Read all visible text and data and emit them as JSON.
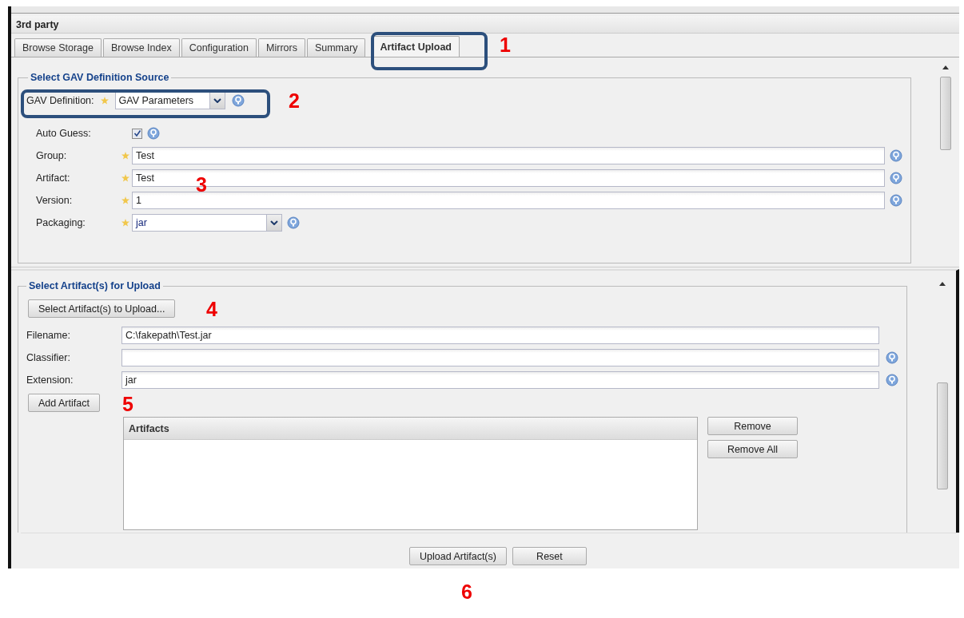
{
  "panel": {
    "title": "3rd party"
  },
  "tabs": [
    {
      "label": "Browse Storage",
      "selected": false
    },
    {
      "label": "Browse Index",
      "selected": false
    },
    {
      "label": "Configuration",
      "selected": false
    },
    {
      "label": "Mirrors",
      "selected": false
    },
    {
      "label": "Summary",
      "selected": false
    },
    {
      "label": "Artifact Upload",
      "selected": true
    }
  ],
  "gav_section": {
    "title": "Select GAV Definition Source",
    "gav_definition": {
      "label": "GAV Definition:",
      "value": "GAV Parameters",
      "required": true,
      "help": true
    },
    "fields": [
      {
        "kind": "checkbox",
        "label": "Auto Guess:",
        "checked": true,
        "required": false,
        "help": true
      },
      {
        "kind": "text",
        "label": "Group:",
        "value": "Test",
        "required": true,
        "help": true
      },
      {
        "kind": "text",
        "label": "Artifact:",
        "value": "Test",
        "required": true,
        "help": true
      },
      {
        "kind": "text",
        "label": "Version:",
        "value": "1",
        "required": true,
        "help": true
      },
      {
        "kind": "select",
        "label": "Packaging:",
        "value": "jar",
        "required": true,
        "help": true
      }
    ]
  },
  "artifact_section": {
    "title": "Select Artifact(s) for Upload",
    "select_button": "Select Artifact(s) to Upload...",
    "fields": [
      {
        "label": "Filename:",
        "value": "C:\\fakepath\\Test.jar",
        "help": false
      },
      {
        "label": "Classifier:",
        "help": true
      },
      {
        "label": "Extension:",
        "value": "jar",
        "help": true
      }
    ],
    "add_button": "Add Artifact",
    "artifacts_grid": {
      "columns": [
        "Artifacts"
      ]
    },
    "side_buttons": [
      "Remove",
      "Remove All"
    ]
  },
  "footer_buttons": [
    "Upload Artifact(s)",
    "Reset"
  ],
  "annotations": [
    {
      "label": "1",
      "outlined": true
    },
    {
      "label": "2",
      "outlined": true
    },
    {
      "label": "3",
      "outlined": false
    },
    {
      "label": "4",
      "outlined": false
    },
    {
      "label": "5",
      "outlined": false
    },
    {
      "label": "6",
      "outlined": false
    }
  ]
}
